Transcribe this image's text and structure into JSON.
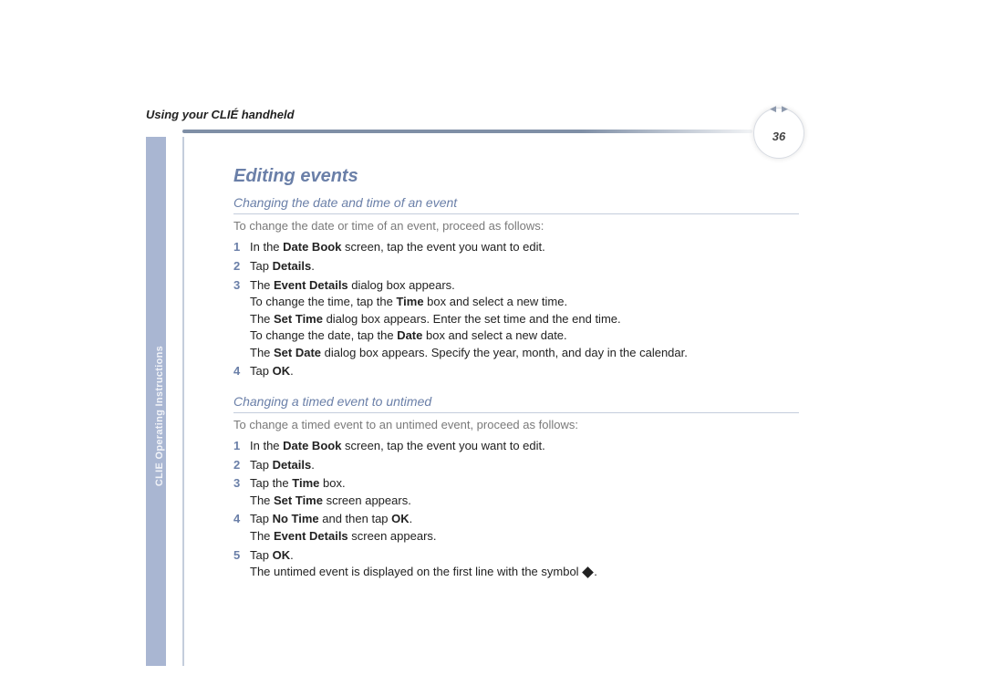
{
  "header": {
    "title": "Using your CLIÉ handheld",
    "page_number": "36",
    "nav_prev": "◀",
    "nav_next": "▶"
  },
  "side_tab": "CLIE Operating Instructions",
  "content": {
    "title": "Editing events",
    "section1": {
      "heading": "Changing the date and time of an event",
      "intro": "To change the date or time of an event, proceed as follows:",
      "steps": [
        {
          "n": "1",
          "lines": [
            [
              {
                "t": "In the "
              },
              {
                "t": "Date Book",
                "b": true
              },
              {
                "t": " screen, tap the event you want to edit."
              }
            ]
          ]
        },
        {
          "n": "2",
          "lines": [
            [
              {
                "t": "Tap "
              },
              {
                "t": "Details",
                "b": true
              },
              {
                "t": "."
              }
            ]
          ]
        },
        {
          "n": "3",
          "lines": [
            [
              {
                "t": "The "
              },
              {
                "t": "Event Details",
                "b": true
              },
              {
                "t": " dialog box appears."
              }
            ],
            [
              {
                "t": "To change the time, tap the "
              },
              {
                "t": "Time",
                "b": true
              },
              {
                "t": " box and select a new time."
              }
            ],
            [
              {
                "t": "The "
              },
              {
                "t": "Set Time",
                "b": true
              },
              {
                "t": " dialog box appears. Enter the set time and the end time."
              }
            ],
            [
              {
                "t": "To change the date, tap the "
              },
              {
                "t": "Date",
                "b": true
              },
              {
                "t": " box and select a new date."
              }
            ],
            [
              {
                "t": "The "
              },
              {
                "t": "Set Date",
                "b": true
              },
              {
                "t": " dialog box appears. Specify the year, month, and day in the calendar."
              }
            ]
          ]
        },
        {
          "n": "4",
          "lines": [
            [
              {
                "t": "Tap "
              },
              {
                "t": "OK",
                "b": true
              },
              {
                "t": "."
              }
            ]
          ]
        }
      ]
    },
    "section2": {
      "heading": "Changing a timed event to untimed",
      "intro": "To change a timed event to an untimed event, proceed as follows:",
      "steps": [
        {
          "n": "1",
          "lines": [
            [
              {
                "t": "In the "
              },
              {
                "t": "Date Book",
                "b": true
              },
              {
                "t": " screen, tap the event you want to edit."
              }
            ]
          ]
        },
        {
          "n": "2",
          "lines": [
            [
              {
                "t": "Tap "
              },
              {
                "t": "Details",
                "b": true
              },
              {
                "t": "."
              }
            ]
          ]
        },
        {
          "n": "3",
          "lines": [
            [
              {
                "t": "Tap the "
              },
              {
                "t": "Time",
                "b": true
              },
              {
                "t": " box."
              }
            ],
            [
              {
                "t": "The "
              },
              {
                "t": "Set Time",
                "b": true
              },
              {
                "t": " screen appears."
              }
            ]
          ]
        },
        {
          "n": "4",
          "lines": [
            [
              {
                "t": "Tap "
              },
              {
                "t": "No Time",
                "b": true
              },
              {
                "t": " and then tap "
              },
              {
                "t": "OK",
                "b": true
              },
              {
                "t": "."
              }
            ],
            [
              {
                "t": "The "
              },
              {
                "t": "Event Details",
                "b": true
              },
              {
                "t": " screen appears."
              }
            ]
          ]
        },
        {
          "n": "5",
          "lines": [
            [
              {
                "t": "Tap "
              },
              {
                "t": "OK",
                "b": true
              },
              {
                "t": "."
              }
            ],
            [
              {
                "t": "The untimed event is displayed on the first line with the symbol "
              },
              {
                "sym": "diamond"
              },
              {
                "t": "."
              }
            ]
          ]
        }
      ]
    }
  }
}
